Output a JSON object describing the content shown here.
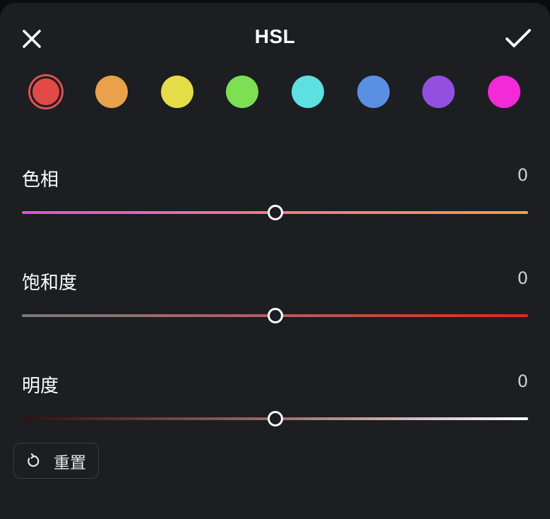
{
  "header": {
    "title": "HSL",
    "close_icon": "close-icon",
    "confirm_icon": "checkmark-icon"
  },
  "swatches": [
    {
      "name": "red",
      "color": "#e24a47",
      "selected": true
    },
    {
      "name": "orange",
      "color": "#e9a14c",
      "selected": false
    },
    {
      "name": "yellow",
      "color": "#e4dd47",
      "selected": false
    },
    {
      "name": "green",
      "color": "#7ddf54",
      "selected": false
    },
    {
      "name": "cyan",
      "color": "#5ee0e0",
      "selected": false
    },
    {
      "name": "blue",
      "color": "#5b8fe3",
      "selected": false
    },
    {
      "name": "purple",
      "color": "#934fe0",
      "selected": false
    },
    {
      "name": "magenta",
      "color": "#f42ad9",
      "selected": false
    }
  ],
  "sliders": {
    "hue": {
      "label": "色相",
      "value": "0",
      "level": 0.5,
      "gradient": [
        "#e64fd9",
        "#e97d8a",
        "#e8a050"
      ]
    },
    "saturation": {
      "label": "饱和度",
      "value": "0",
      "level": 0.5,
      "gradient": [
        "#7a7a7a",
        "#b06060",
        "#e4261e"
      ]
    },
    "lightness": {
      "label": "明度",
      "value": "0",
      "level": 0.5,
      "gradient": [
        "#3a0b0b",
        "#a06a6a",
        "#ffffff"
      ]
    }
  },
  "reset": {
    "label": "重置",
    "icon": "reset-icon"
  }
}
